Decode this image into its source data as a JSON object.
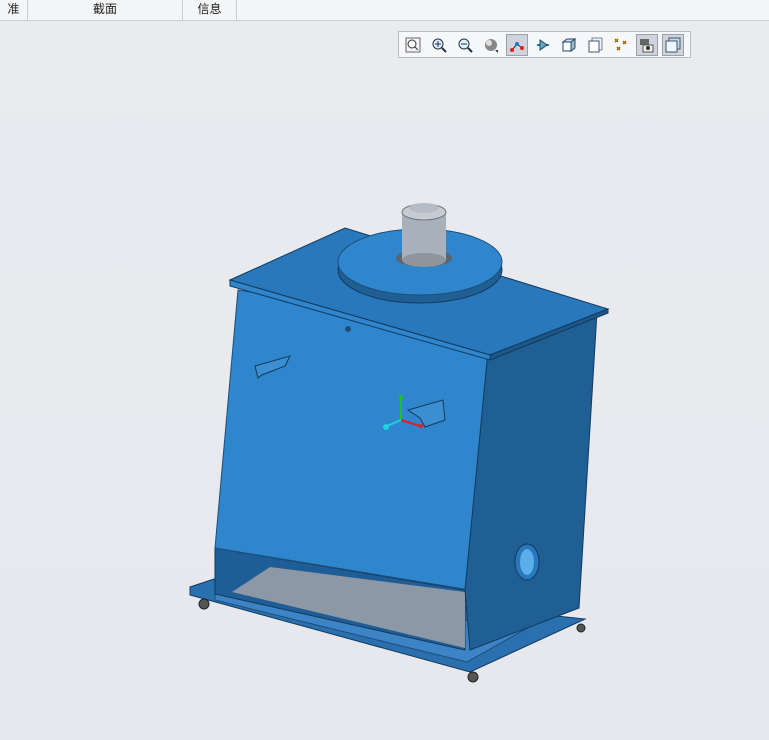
{
  "tabs": [
    {
      "label": "准"
    },
    {
      "label": "截面"
    },
    {
      "label": "信息"
    }
  ],
  "toolbar": {
    "buttons": [
      {
        "icon": "zoom-fit-icon",
        "active": false
      },
      {
        "icon": "zoom-in-icon",
        "active": false
      },
      {
        "icon": "zoom-out-icon",
        "active": false
      },
      {
        "icon": "shading-icon",
        "active": false
      },
      {
        "icon": "datum-display-icon",
        "active": true
      },
      {
        "icon": "axis-display-icon",
        "active": false
      },
      {
        "icon": "view-cube-icon",
        "active": false
      },
      {
        "icon": "saved-views-icon",
        "active": false
      },
      {
        "icon": "point-display-icon",
        "active": false
      },
      {
        "icon": "display-style-icon",
        "active": true
      },
      {
        "icon": "appearance-icon",
        "active": true
      }
    ]
  },
  "colors": {
    "model_front": "#2f86cc",
    "model_side": "#1f5f94",
    "model_top": "#2a78bc",
    "motor": "#a8b0bb",
    "axis_x": "#e02020",
    "axis_y": "#20c020",
    "axis_z": "#20d0e0"
  }
}
